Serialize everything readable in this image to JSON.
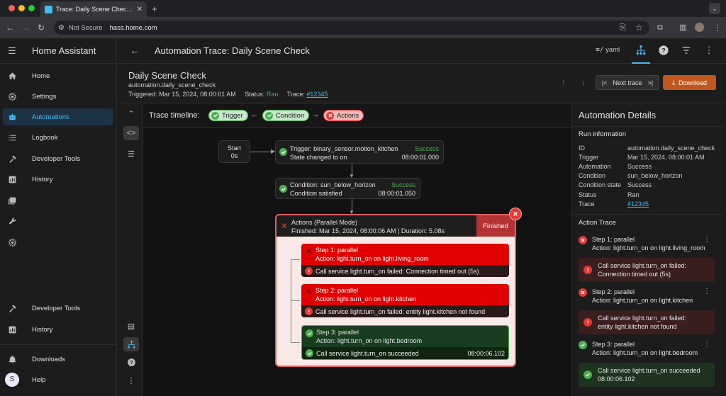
{
  "browser": {
    "tab_title": "Trace: Daily Scene Check - Home Assistant",
    "new_tab": "+",
    "security_label": "Not Secure",
    "url": "hass.home.com"
  },
  "sidebar": {
    "app_name": "Home Assistant",
    "items": [
      {
        "label": "Home",
        "icon": "home-icon"
      },
      {
        "label": "Settings",
        "icon": "gear-icon"
      },
      {
        "label": "Automations",
        "icon": "robot-icon"
      },
      {
        "label": "Logbook",
        "icon": "list-icon"
      },
      {
        "label": "Developer Tools",
        "icon": "hammer-icon"
      },
      {
        "label": "History",
        "icon": "chart-icon"
      },
      {
        "label": "",
        "icon": "media-icon"
      },
      {
        "label": "",
        "icon": "wrench-icon"
      },
      {
        "label": "",
        "icon": "cog-icon"
      },
      {
        "label": "Developer Tools",
        "icon": "hammer-icon"
      },
      {
        "label": "History",
        "icon": "chart-icon"
      },
      {
        "label": "Downloads",
        "icon": "bell-icon"
      },
      {
        "label": "Help",
        "icon": "user-avatar"
      }
    ],
    "avatar_initial": "S"
  },
  "header": {
    "title": "Automation Trace: Daily Scene Check",
    "yaml_label": "yaml"
  },
  "automation": {
    "name": "Daily Scene Check",
    "entity_id": "automation.daily_scene_check",
    "triggered_label": "Triggered:",
    "triggered_value": "Mar 15, 2024, 08:00:01 AM",
    "status_label": "Status:",
    "status_value": "Ran",
    "trace_label": "Trace:",
    "trace_value": "#12345",
    "next_trace": "Next trace",
    "download": "Download"
  },
  "timeline": {
    "label": "Trace timeline:",
    "chips": [
      "Trigger",
      "Condition",
      "Actions"
    ]
  },
  "graph": {
    "start": {
      "label": "Start",
      "time": "0s"
    },
    "trigger": {
      "title": "Trigger: binary_sensor.motion_kitchen",
      "status": "Success",
      "detail": "State changed to on",
      "time": "08:00:01.000"
    },
    "condition": {
      "title": "Condition: sun_below_horizon",
      "status": "Success",
      "detail": "Condition satisfied",
      "time": "08:00:01.050"
    },
    "actions": {
      "title": "Actions (Parallel Mode)",
      "detail": "Finished: Mar 15, 2024, 08:00:06 AM | Duration: 5.08s",
      "badge": "Finished"
    },
    "steps": [
      {
        "title": "Step 1: parallel",
        "action": "Action: light.turn_on on light.living_room",
        "result": "Call service light.turn_on failed: Connection timed out (5s)",
        "time": "",
        "ok": false
      },
      {
        "title": "Step 2: parallel",
        "action": "Action: light.turn_on on light.kitchen",
        "result": "Call service light.turn_on failed: entity light.kitchen not found",
        "time": "",
        "ok": false
      },
      {
        "title": "Step 3: parallel",
        "action": "Action: light.turn_on on light.bedroom",
        "result": "Call service light.turn_on succeeded",
        "time": "08:00:06.102",
        "ok": true
      }
    ]
  },
  "details": {
    "title": "Automation Details",
    "run_info_heading": "Run information",
    "run_info": [
      {
        "key": "ID",
        "value": "automation.daily_scene_check"
      },
      {
        "key": "Trigger",
        "value": "Mar 15, 2024, 08:00:01 AM"
      },
      {
        "key": "Automation",
        "value": "Success"
      },
      {
        "key": "Condition",
        "value": "sun_below_horizon"
      },
      {
        "key": "Condition state",
        "value": "Success"
      },
      {
        "key": "Status",
        "value": "Ran"
      },
      {
        "key": "Trace",
        "value": "#12345"
      }
    ],
    "action_trace_heading": "Action Trace",
    "steps": [
      {
        "title": "Step 1: parallel",
        "action": "Action: light.turn_on on light.living_room",
        "msg1": "Call service light.turn_on failed:",
        "msg2": "Connection timed out (5s)"
      },
      {
        "title": "Step 2: parallel",
        "action": "Action: light.turn_on on light.kitchen",
        "msg1": "Call service light.turn_on failed:",
        "msg2": "entity light.kitchen not found"
      },
      {
        "title": "Step 3: parallel",
        "action": "Action: light.turn_on on light.bedroom",
        "msg1": "Call service light.turn_on succeeded",
        "msg2": "08:00:06.102"
      }
    ]
  },
  "colors": {
    "accent": "#41bdf5",
    "success": "#4caf50",
    "error": "#e53935",
    "download": "#c1571c"
  }
}
